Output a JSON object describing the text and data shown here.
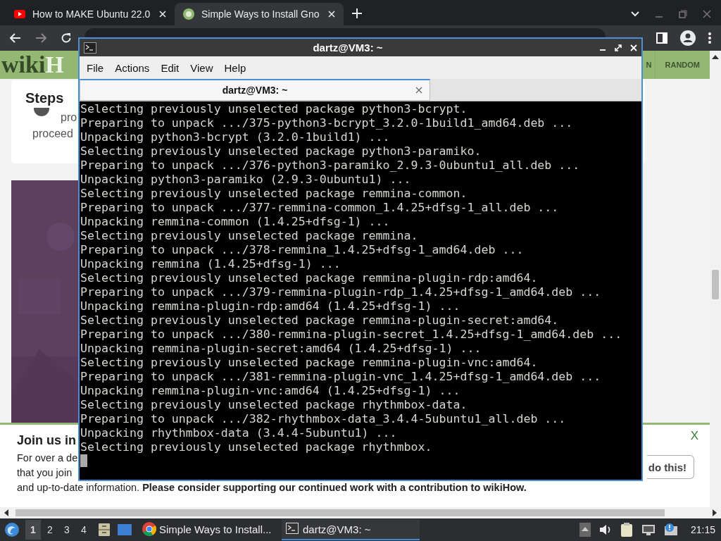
{
  "browser": {
    "tabs": [
      {
        "title": "How to MAKE Ubuntu 22.0",
        "kind": "video",
        "selected": false
      },
      {
        "title": "Simple Ways to Install Gno",
        "kind": "wiki",
        "selected": true
      }
    ]
  },
  "page": {
    "logo": {
      "first": "wiki",
      "second": "H"
    },
    "nav": [
      {
        "label": "N"
      },
      {
        "label": "RANDOM"
      }
    ],
    "steps_card": {
      "heading": "Steps",
      "lines": [
        "pro",
        "proceed"
      ]
    },
    "banner": {
      "title": "Join us in",
      "lines": [
        "For over a de",
        "that you join",
        "and up-to-date information. **Please consider supporting our continued work with a contribution to wikiHow.**"
      ],
      "button": "do this!",
      "close": "X"
    }
  },
  "terminal": {
    "title": "dartz@VM3: ~",
    "menu": [
      "File",
      "Actions",
      "Edit",
      "View",
      "Help"
    ],
    "tab": {
      "title": "dartz@VM3: ~",
      "selected": true
    },
    "lines": [
      "Selecting previously unselected package python3-bcrypt.",
      "Preparing to unpack .../375-python3-bcrypt_3.2.0-1build1_amd64.deb ...",
      "Unpacking python3-bcrypt (3.2.0-1build1) ...",
      "Selecting previously unselected package python3-paramiko.",
      "Preparing to unpack .../376-python3-paramiko_2.9.3-0ubuntu1_all.deb ...",
      "Unpacking python3-paramiko (2.9.3-0ubuntu1) ...",
      "Selecting previously unselected package remmina-common.",
      "Preparing to unpack .../377-remmina-common_1.4.25+dfsg-1_all.deb ...",
      "Unpacking remmina-common (1.4.25+dfsg-1) ...",
      "Selecting previously unselected package remmina.",
      "Preparing to unpack .../378-remmina_1.4.25+dfsg-1_amd64.deb ...",
      "Unpacking remmina (1.4.25+dfsg-1) ...",
      "Selecting previously unselected package remmina-plugin-rdp:amd64.",
      "Preparing to unpack .../379-remmina-plugin-rdp_1.4.25+dfsg-1_amd64.deb ...",
      "Unpacking remmina-plugin-rdp:amd64 (1.4.25+dfsg-1) ...",
      "Selecting previously unselected package remmina-plugin-secret:amd64.",
      "Preparing to unpack .../380-remmina-plugin-secret_1.4.25+dfsg-1_amd64.deb ...",
      "Unpacking remmina-plugin-secret:amd64 (1.4.25+dfsg-1) ...",
      "Selecting previously unselected package remmina-plugin-vnc:amd64.",
      "Preparing to unpack .../381-remmina-plugin-vnc_1.4.25+dfsg-1_amd64.deb ...",
      "Unpacking remmina-plugin-vnc:amd64 (1.4.25+dfsg-1) ...",
      "Selecting previously unselected package rhythmbox-data.",
      "Preparing to unpack .../382-rhythmbox-data_3.4.4-5ubuntu1_all.deb ...",
      "Unpacking rhythmbox-data (3.4.4-5ubuntu1) ...",
      "Selecting previously unselected package rhythmbox."
    ]
  },
  "taskbar": {
    "workspaces": [
      {
        "label": "1",
        "selected": true
      },
      {
        "label": "2",
        "selected": false
      },
      {
        "label": "3",
        "selected": false
      },
      {
        "label": "4",
        "selected": false
      }
    ],
    "tasks": [
      {
        "title": "Simple Ways to Install...",
        "kind": "browser",
        "selected": false
      },
      {
        "title": "dartz@VM3: ~",
        "kind": "terminal",
        "selected": true
      }
    ],
    "clock": "21:15"
  }
}
